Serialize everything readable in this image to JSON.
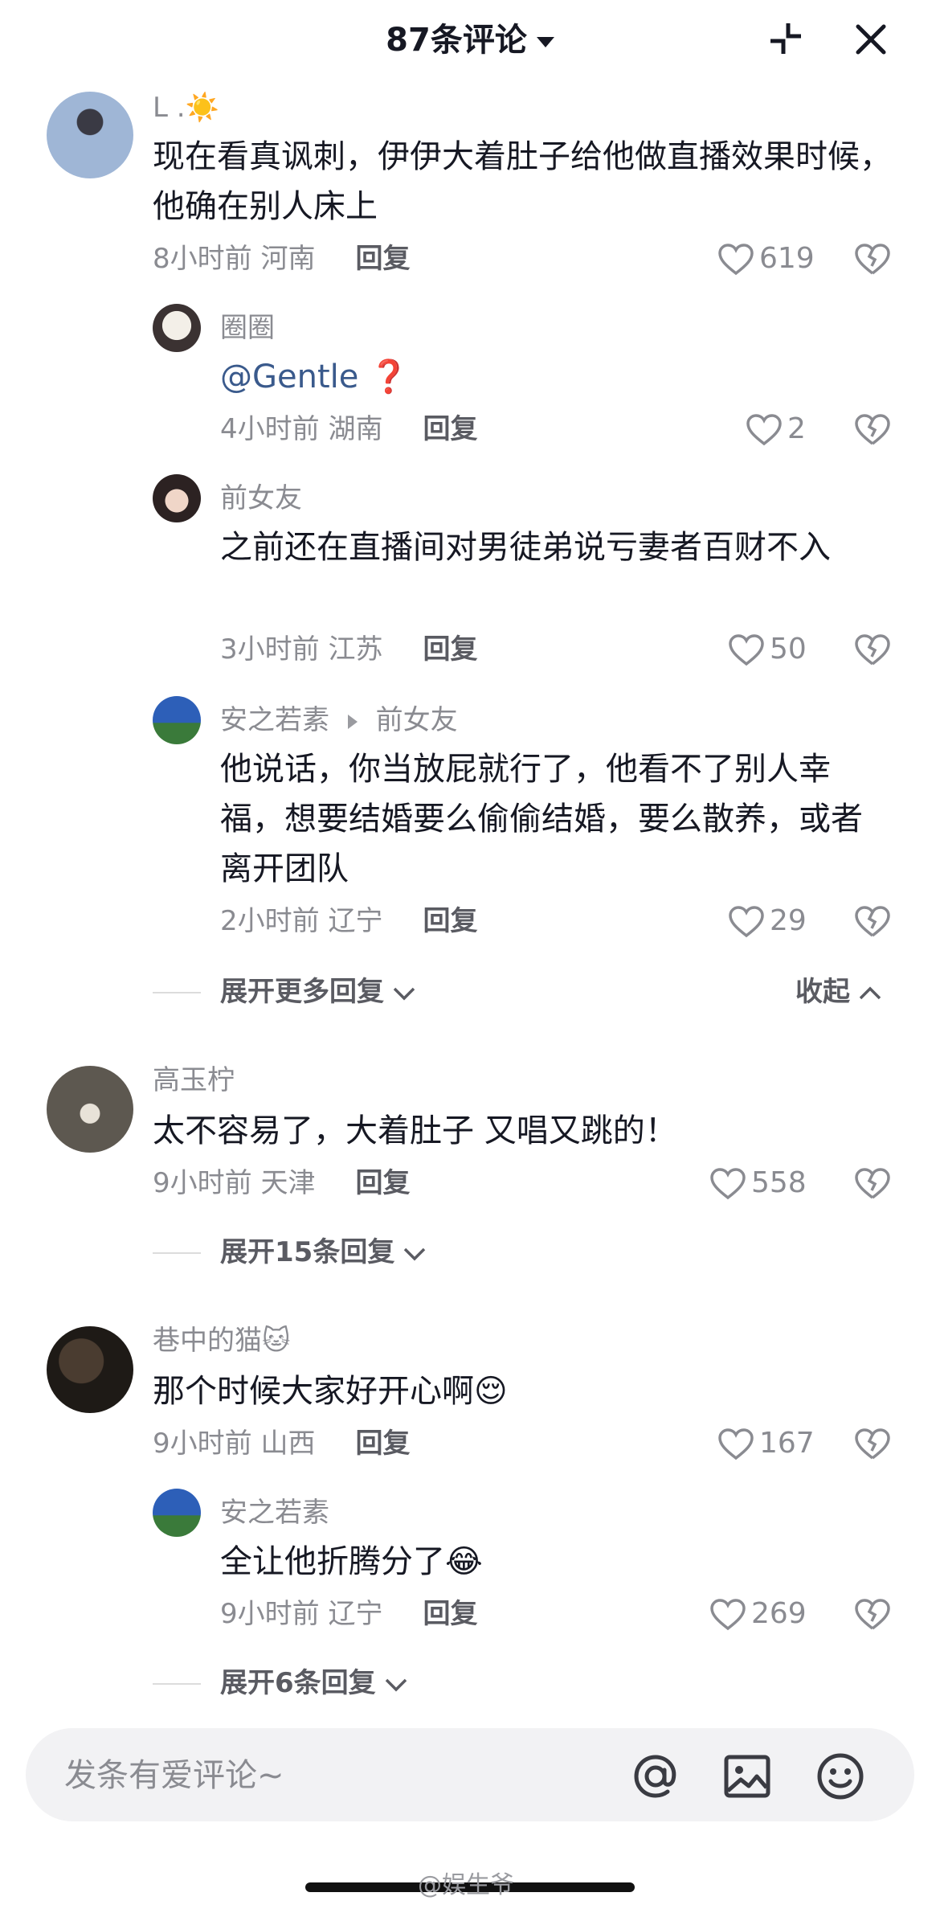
{
  "header": {
    "title": "87条评论"
  },
  "comments": [
    {
      "username": "L .☀️",
      "text": "现在看真讽刺，伊伊大着肚子给他做直播效果时候，他确在别人床上",
      "time_location": "8小时前 河南",
      "reply_label": "回复",
      "likes": "619"
    },
    {
      "username": "圈圈",
      "mention": "@Gentle",
      "emoji": "❓",
      "time_location": "4小时前 湖南",
      "reply_label": "回复",
      "likes": "2"
    },
    {
      "username": "前女友",
      "text": "之前还在直播间对男徒弟说亏妻者百财不入",
      "time_location": "3小时前 江苏",
      "reply_label": "回复",
      "likes": "50"
    },
    {
      "username": "安之若素",
      "reply_to": "前女友",
      "text": "他说话，你当放屁就行了，他看不了别人幸福，想要结婚要么偷偷结婚，要么散养，或者离开团队",
      "time_location": "2小时前 辽宁",
      "reply_label": "回复",
      "likes": "29"
    },
    {
      "username": "高玉柠",
      "text": "太不容易了，大着肚子 又唱又跳的！",
      "time_location": "9小时前 天津",
      "reply_label": "回复",
      "likes": "558"
    },
    {
      "username": "巷中的猫🐱",
      "text": "那个时候大家好开心啊😌",
      "time_location": "9小时前 山西",
      "reply_label": "回复",
      "likes": "167"
    },
    {
      "username": "安之若素",
      "text": "全让他折腾分了😂",
      "time_location": "9小时前 辽宁",
      "reply_label": "回复",
      "likes": "269"
    }
  ],
  "expanders": {
    "more_replies": "展开更多回复",
    "collapse": "收起",
    "expand_15": "展开15条回复",
    "expand_6": "展开6条回复"
  },
  "input": {
    "placeholder": "发条有爱评论~"
  },
  "watermark": "@娱生爷",
  "icons": [
    "collapse-icon",
    "close-icon",
    "heart-icon",
    "broken-heart-icon",
    "at-icon",
    "image-icon",
    "emoji-icon"
  ]
}
